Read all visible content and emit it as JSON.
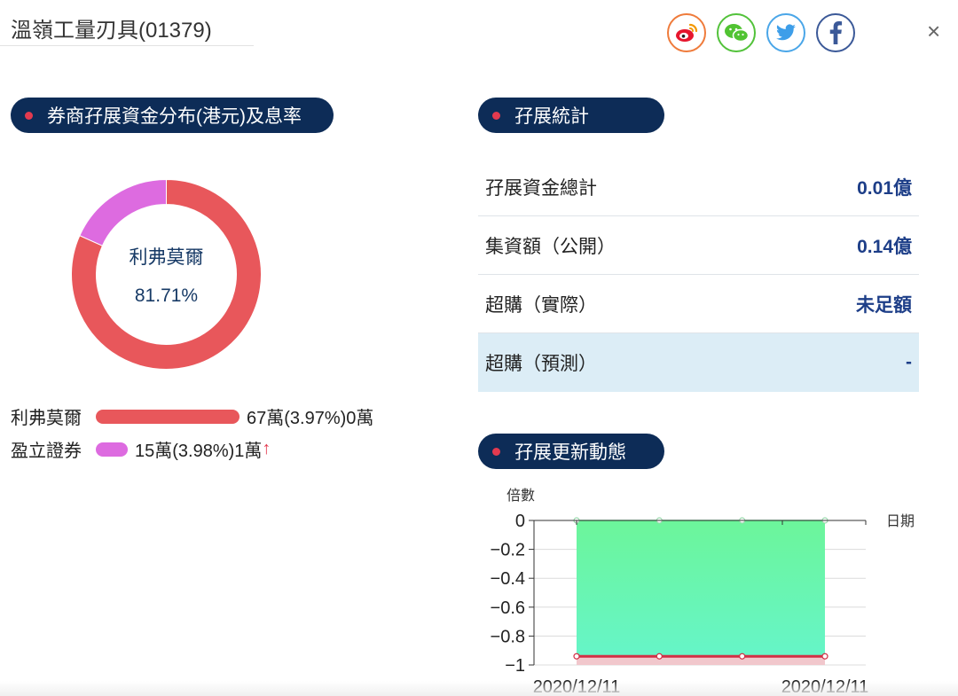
{
  "header": {
    "title": "溫嶺工量刃具(01379)",
    "share_icons": [
      "weibo-icon",
      "wechat-icon",
      "twitter-icon",
      "facebook-icon"
    ],
    "close_label": "×"
  },
  "sections": {
    "broker_dist_title": "券商孖展資金分布(港元)及息率",
    "margin_stats_title": "孖展統計",
    "margin_updates_title": "孖展更新動態"
  },
  "donut": {
    "center_name": "利弗莫爾",
    "center_percent": "81.71%",
    "slices": [
      {
        "name": "利弗莫爾",
        "fraction": 0.8171,
        "color": "#e8575b"
      },
      {
        "name": "盈立證券",
        "fraction": 0.1829,
        "color": "#dd6be0"
      }
    ]
  },
  "brokers": [
    {
      "name": "利弗莫爾",
      "detail": "67萬(3.97%)0萬",
      "arrow": "",
      "color": "#e8575b"
    },
    {
      "name": "盈立證券",
      "detail": "15萬(3.98%)1萬",
      "arrow": "↑",
      "color": "#dd6be0"
    }
  ],
  "stats": [
    {
      "label": "孖展資金總計",
      "value": "0.01億"
    },
    {
      "label": "集資額（公開）",
      "value": "0.14億"
    },
    {
      "label": "超購（實際）",
      "value": "未足額"
    },
    {
      "label": "超購（預測）",
      "value": "-"
    }
  ],
  "chart_data": {
    "type": "area",
    "ylabel": "倍數",
    "xlabel": "日期",
    "ylim": [
      -1,
      0
    ],
    "yticks": [
      0,
      -0.2,
      -0.4,
      -0.6,
      -0.8,
      -1
    ],
    "ytick_labels": [
      "0",
      "−0.2",
      "−0.4",
      "−0.6",
      "−0.8",
      "−1"
    ],
    "xtick_labels": [
      "2020/12/11",
      "2020/12/11"
    ],
    "grid": true,
    "series": [
      {
        "color": "#6cf59a",
        "values": [
          0,
          0,
          0,
          0
        ]
      },
      {
        "color": "#d22f45",
        "values": [
          -0.94,
          -0.94,
          -0.94,
          -0.94
        ]
      }
    ]
  }
}
